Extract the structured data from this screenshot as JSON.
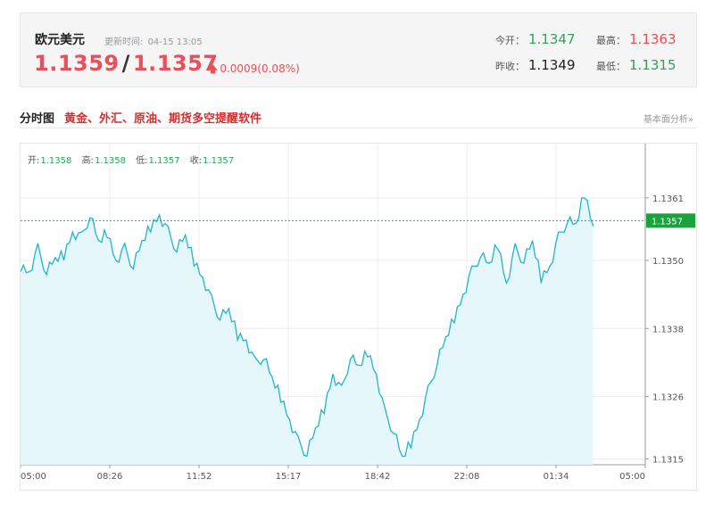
{
  "quote": {
    "name": "欧元美元",
    "update_label": "更新时间:",
    "update_time": "04-15 13:05",
    "bid": "1.1359",
    "ask": "1.1357",
    "change": "0.0009(0.08%)",
    "open_label": "今开：",
    "open_value": "1.1347",
    "high_label": "最高：",
    "high_value": "1.1363",
    "prev_label": "昨收：",
    "prev_value": "1.1349",
    "low_label": "最低：",
    "low_value": "1.1315"
  },
  "section": {
    "title": "分时图",
    "link": "黄金、外汇、原油、期货多空提醒软件",
    "more": "基本面分析»"
  },
  "colors": {
    "up": "#e8505b",
    "down": "#2aa55b",
    "line": "#1fb5cf",
    "fill": "#e6f7fb",
    "badge": "#19a33a"
  },
  "chart_data": {
    "type": "line",
    "ohlc": [
      {
        "label": "开:",
        "value": "1.1358"
      },
      {
        "label": "高:",
        "value": "1.1358"
      },
      {
        "label": "低:",
        "value": "1.1357"
      },
      {
        "label": "收:",
        "value": "1.1357"
      }
    ],
    "y_ticks": [
      "1.1361",
      "1.1350",
      "1.1338",
      "1.1326",
      "1.1315"
    ],
    "y_tick_values": [
      1.1361,
      1.135,
      1.1338,
      1.1326,
      1.1315
    ],
    "ylim": [
      1.1314,
      1.1369
    ],
    "x_ticks": [
      "05:00",
      "08:26",
      "11:52",
      "15:17",
      "18:42",
      "22:08",
      "01:34",
      "05:00"
    ],
    "current_price": "1.1357",
    "current_value": 1.1357,
    "grid": true,
    "series": [
      {
        "values": [
          1.1349,
          1.1348,
          1.1352,
          1.1348,
          1.135,
          1.1351,
          1.1355,
          1.1354,
          1.1358,
          1.1353,
          1.1355,
          1.135,
          1.1352,
          1.1349,
          1.1353,
          1.1356,
          1.1358,
          1.1355,
          1.1352,
          1.1354,
          1.135,
          1.1347,
          1.1343,
          1.134,
          1.1341,
          1.1337,
          1.1336,
          1.1332,
          1.1333,
          1.1329,
          1.1326,
          1.1322,
          1.1318,
          1.1316,
          1.132,
          1.1324,
          1.133,
          1.1327,
          1.1333,
          1.1331,
          1.1334,
          1.133,
          1.1323,
          1.132,
          1.1315,
          1.1318,
          1.1322,
          1.1327,
          1.1332,
          1.1336,
          1.134,
          1.1344,
          1.1348,
          1.1351,
          1.1349,
          1.1353,
          1.1346,
          1.1352,
          1.135,
          1.1353,
          1.1347,
          1.1349,
          1.1354,
          1.1357,
          1.1356,
          1.1362,
          1.1356
        ]
      }
    ],
    "total_points": 217
  }
}
